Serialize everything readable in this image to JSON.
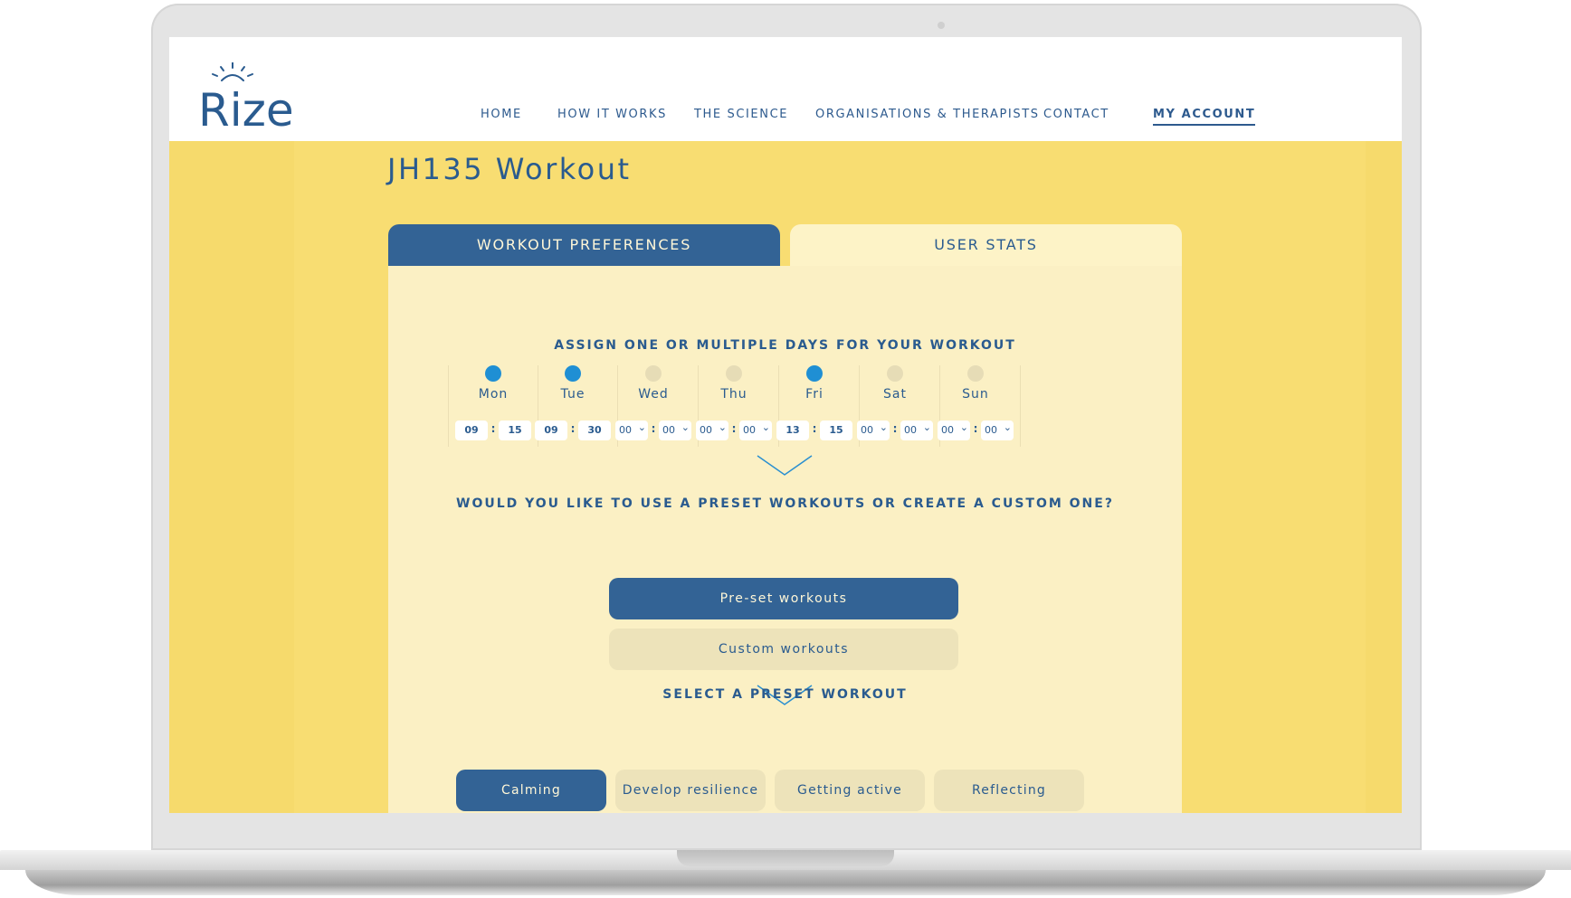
{
  "brand": {
    "logo_text": "Rize"
  },
  "nav": {
    "items": [
      "HOME",
      "HOW IT WORKS",
      "THE SCIENCE",
      "ORGANISATIONS & THERAPISTS",
      "CONTACT",
      "MY ACCOUNT"
    ],
    "active": "MY ACCOUNT"
  },
  "page": {
    "title": "JH135 Workout"
  },
  "tabs": [
    {
      "label": "WORKOUT PREFERENCES",
      "active": true
    },
    {
      "label": "USER STATS",
      "active": false
    }
  ],
  "days_section": {
    "heading": "ASSIGN ONE OR MULTIPLE DAYS FOR YOUR WORKOUT",
    "days": [
      {
        "label": "Mon",
        "selected": true,
        "hour": "09",
        "minute": "15"
      },
      {
        "label": "Tue",
        "selected": true,
        "hour": "09",
        "minute": "30"
      },
      {
        "label": "Wed",
        "selected": false,
        "hour": "00",
        "minute": "00"
      },
      {
        "label": "Thu",
        "selected": false,
        "hour": "00",
        "minute": "00"
      },
      {
        "label": "Fri",
        "selected": true,
        "hour": "13",
        "minute": "15"
      },
      {
        "label": "Sat",
        "selected": false,
        "hour": "00",
        "minute": "00"
      },
      {
        "label": "Sun",
        "selected": false,
        "hour": "00",
        "minute": "00"
      }
    ],
    "separator": ":"
  },
  "mode_section": {
    "heading": "WOULD YOU LIKE TO USE A PRESET WORKOUTS OR CREATE A CUSTOM ONE?",
    "preset_button": "Pre-set workouts",
    "custom_button": "Custom workouts"
  },
  "preset_section": {
    "heading": "SELECT A PRESET WORKOUT",
    "options": [
      "Calming",
      "Develop resilience",
      "Getting active",
      "Reflecting"
    ],
    "active": "Calming"
  },
  "colors": {
    "primary_blue": "#336395",
    "selected_dot": "#1f8fd4",
    "background_yellow": "#f6da6c",
    "panel_cream": "#fbf0c4"
  }
}
